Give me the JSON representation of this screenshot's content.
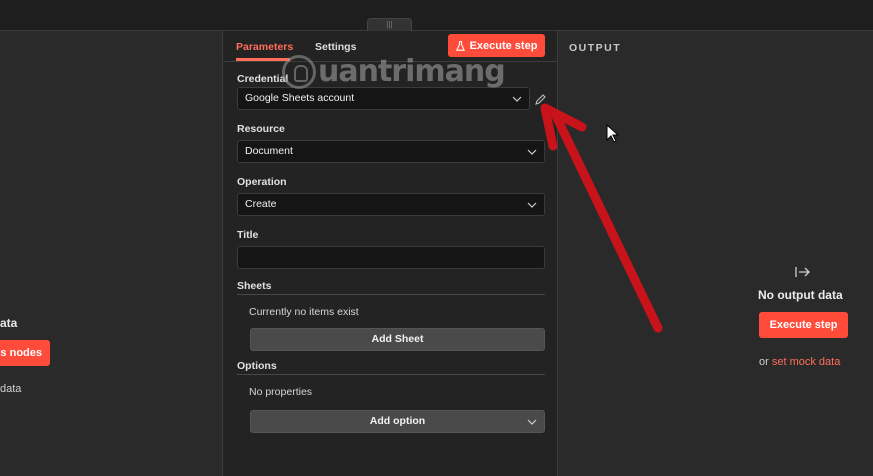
{
  "topbar": {
    "handle_glyph": "|||"
  },
  "left": {
    "title": "ata",
    "button_label": "s nodes",
    "text": "data"
  },
  "panel": {
    "tabs": [
      {
        "label": "Parameters",
        "active": true
      },
      {
        "label": "Settings",
        "active": false
      }
    ],
    "execute_label": "Execute step",
    "credential": {
      "label": "Credential",
      "value": "Google Sheets account"
    },
    "resource": {
      "label": "Resource",
      "value": "Document"
    },
    "operation": {
      "label": "Operation",
      "value": "Create"
    },
    "title_field": {
      "label": "Title",
      "value": ""
    },
    "sheets": {
      "label": "Sheets",
      "empty_text": "Currently no items exist",
      "add_label": "Add Sheet"
    },
    "options": {
      "label": "Options",
      "empty_text": "No properties",
      "add_label": "Add option"
    }
  },
  "output": {
    "title": "OUTPUT",
    "empty_title": "No output data",
    "execute_label": "Execute step",
    "or_text": "or",
    "mock_link": "set mock data"
  },
  "watermark": {
    "text": "uantrimang"
  },
  "colors": {
    "accent": "#ff4b3a",
    "accent_text": "#ff6d5a",
    "panel_bg": "#232323",
    "canvas_bg": "#2a2a2a",
    "annotation_arrow": "#c8131b"
  },
  "icons": [
    "flask-icon",
    "chevron-down-icon",
    "pencil-icon",
    "arrow-into-icon",
    "drag-handle-icon",
    "mouse-cursor-icon"
  ]
}
